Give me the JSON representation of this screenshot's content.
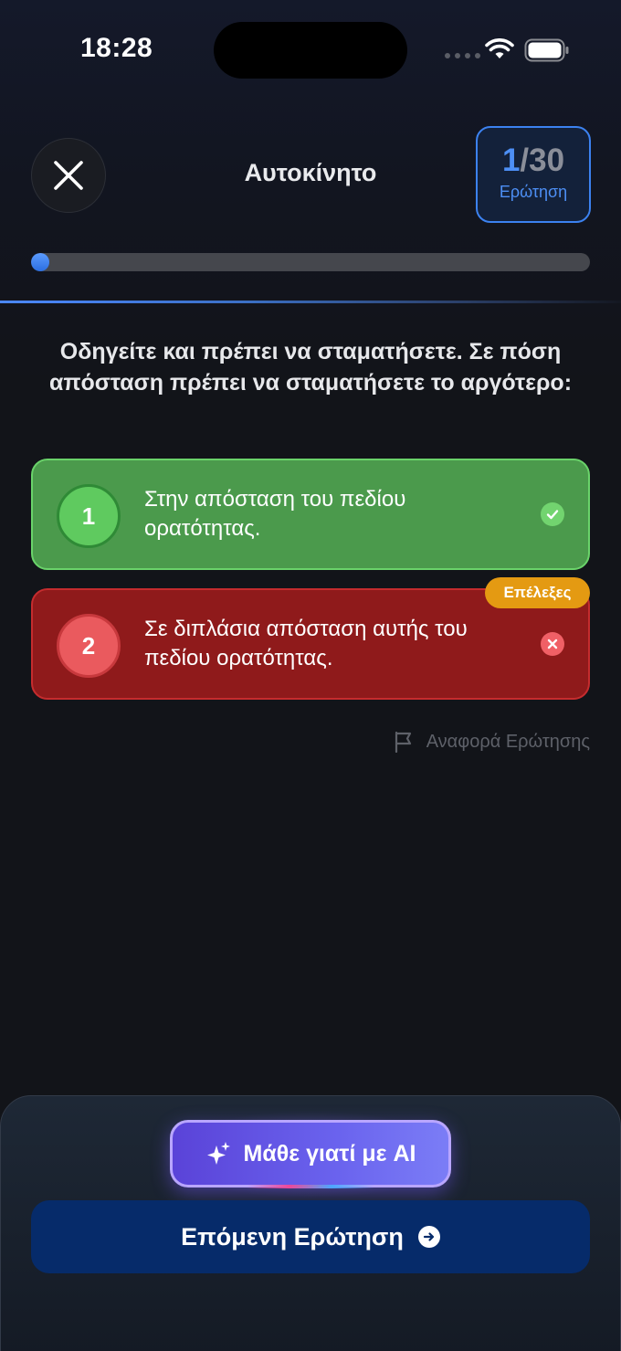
{
  "status_bar": {
    "time": "18:28"
  },
  "header": {
    "title": "Αυτοκίνητο",
    "counter_current": "1",
    "counter_total": "/30",
    "counter_label": "Ερώτηση"
  },
  "progress": {
    "fraction": 0.033
  },
  "question": "Οδηγείτε και πρέπει να σταματήσετε. Σε πόση απόσταση πρέπει να σταματήσετε το αργότερο:",
  "answers": [
    {
      "number": "1",
      "text": "Στην απόσταση του πεδίου ορατότητας.",
      "state": "correct"
    },
    {
      "number": "2",
      "text": "Σε διπλάσια απόσταση αυτής του πεδίου ορατότητας.",
      "state": "wrong"
    }
  ],
  "chosen_tag": "Επέλεξες",
  "report_label": "Αναφορά Ερώτησης",
  "ai_button_label": "Μάθε γιατί με AI",
  "next_button_label": "Επόμενη Ερώτηση",
  "colors": {
    "accent": "#3c82f0",
    "correct": "#4b9a4c",
    "wrong": "#8f1a1b",
    "chosen_tag": "#e49a12",
    "next_button": "#062b6a"
  },
  "icons": [
    "close-icon",
    "check-icon",
    "x-icon",
    "flag-icon",
    "sparkles-icon",
    "arrow-right-circle-icon",
    "wifi-icon",
    "battery-icon"
  ]
}
